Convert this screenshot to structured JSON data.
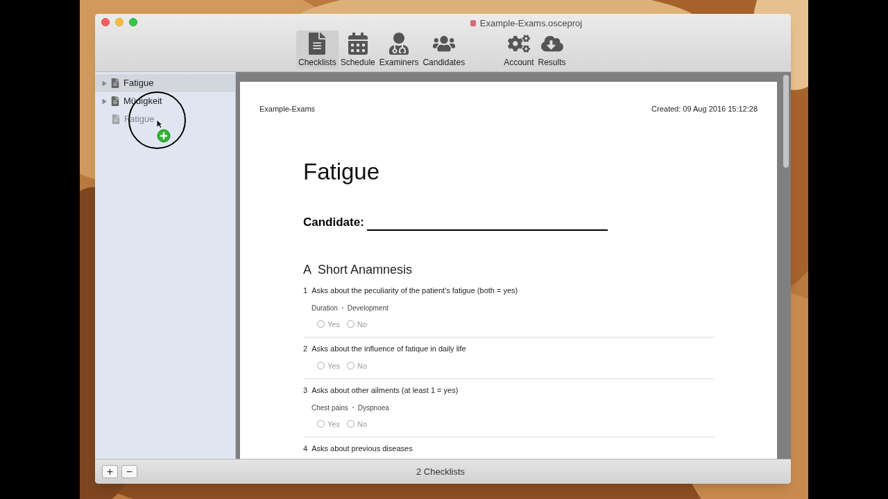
{
  "window": {
    "title": "Example-Exams.osceproj"
  },
  "toolbar": [
    {
      "label": "Checklists",
      "selected": true
    },
    {
      "label": "Schedule",
      "selected": false
    },
    {
      "label": "Examiners",
      "selected": false
    },
    {
      "label": "Candidates",
      "selected": false
    },
    {
      "label": "Account",
      "selected": false
    },
    {
      "label": "Results",
      "selected": false
    }
  ],
  "sidebar": {
    "items": [
      {
        "label": "Fatigue",
        "selected": true,
        "dragging": false,
        "expanded": false
      },
      {
        "label": "Müdigkeit",
        "selected": false,
        "dragging": false,
        "expanded": false
      },
      {
        "label": "Fatigue",
        "selected": false,
        "dragging": true
      }
    ]
  },
  "document": {
    "project": "Example-Exams",
    "created": "Created: 09 Aug 2016 15:12:28",
    "title": "Fatigue",
    "candidate_label": "Candidate:",
    "section": {
      "letter": "A",
      "title": "Short Anamnesis"
    },
    "items": [
      {
        "number": "1",
        "text": "Asks about the peculiarity of the patient's fatigue (both = yes)",
        "details": [
          "Duration",
          "Development"
        ],
        "options": [
          {
            "label": "Yes",
            "checked": false
          },
          {
            "label": "No",
            "checked": false
          }
        ]
      },
      {
        "number": "2",
        "text": "Asks about the influence of fatique in daily life",
        "options": [
          {
            "label": "Yes",
            "checked": false
          },
          {
            "label": "No",
            "checked": false
          }
        ]
      },
      {
        "number": "3",
        "text": "Asks about other ailments (at least 1 = yes)",
        "details": [
          "Chest pains",
          "Dyspnoea"
        ],
        "options": [
          {
            "label": "Yes",
            "checked": false
          },
          {
            "label": "No",
            "checked": false
          }
        ]
      },
      {
        "number": "4",
        "text": "Asks about previous diseases"
      }
    ]
  },
  "status_bar": {
    "add": "+",
    "remove": "−",
    "count": "2 Checklists"
  }
}
